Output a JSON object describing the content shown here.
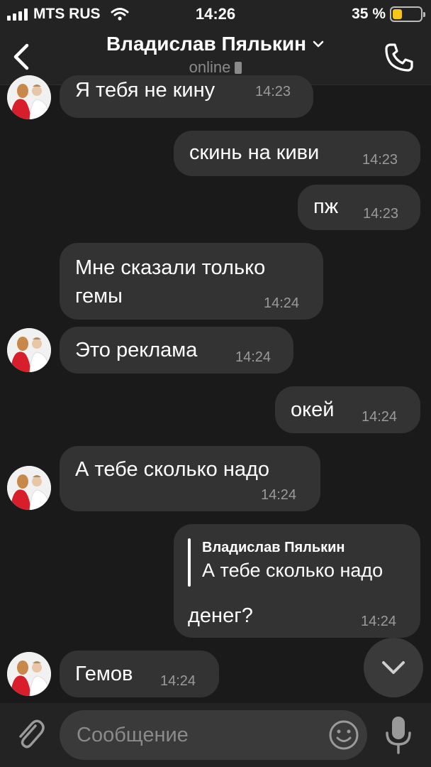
{
  "status_bar": {
    "carrier": "MTS RUS",
    "time": "14:26",
    "battery_text": "35 %",
    "battery_level": 0.35,
    "battery_color": "#f5c518"
  },
  "header": {
    "title": "Владислав Пялькин",
    "status": "online",
    "back_icon": "chevron-left-icon",
    "call_icon": "phone-icon"
  },
  "messages": [
    {
      "side": "in",
      "text": "Я тебя не кину",
      "time": "14:23",
      "avatar": true
    },
    {
      "side": "out",
      "text": "скинь на киви",
      "time": "14:23"
    },
    {
      "side": "out",
      "text": "пж",
      "time": "14:23"
    },
    {
      "side": "in",
      "text_line1": "Мне сказали только",
      "text_line2": "гемы",
      "time": "14:24",
      "avatar": false
    },
    {
      "side": "in",
      "text": "Это реклама",
      "time": "14:24",
      "avatar": true
    },
    {
      "side": "out",
      "text": "окей",
      "time": "14:24"
    },
    {
      "side": "in",
      "text": "А тебе сколько надо",
      "time": "14:24",
      "avatar": true
    },
    {
      "side": "out",
      "reply_to_name": "Владислав Пялькин",
      "reply_to_text": "А тебе сколько надо",
      "text": "денег?",
      "time": "14:24"
    },
    {
      "side": "in",
      "text": "Гемов",
      "time": "14:24",
      "avatar": true
    }
  ],
  "input": {
    "placeholder": "Сообщение",
    "attach_icon": "paperclip-icon",
    "emoji_icon": "smiley-icon",
    "mic_icon": "microphone-icon"
  },
  "scroll_button_icon": "chevron-down-icon",
  "colors": {
    "background": "#1a1a1a",
    "bubble": "#333333",
    "bar": "#232323",
    "time_text": "#9a9a9a"
  }
}
